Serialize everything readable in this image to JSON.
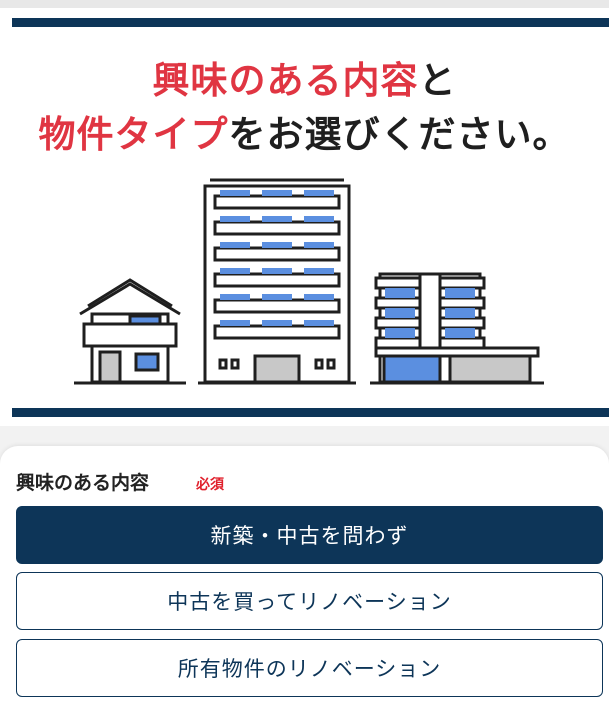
{
  "hero": {
    "headline_line1_red": "興味のある内容",
    "headline_line1_tail": "と",
    "headline_line2_red": "物件タイプ",
    "headline_line2_tail": "をお選びください。"
  },
  "form": {
    "section_title": "興味のある内容",
    "required_label": "必須",
    "options": [
      {
        "label": "新築・中古を問わず",
        "selected": true
      },
      {
        "label": "中古を買ってリノベーション",
        "selected": false
      },
      {
        "label": "所有物件のリノベーション",
        "selected": false
      }
    ]
  },
  "colors": {
    "navy": "#0d3558",
    "accent_red": "#e03542",
    "window_blue": "#5b8fe0"
  }
}
